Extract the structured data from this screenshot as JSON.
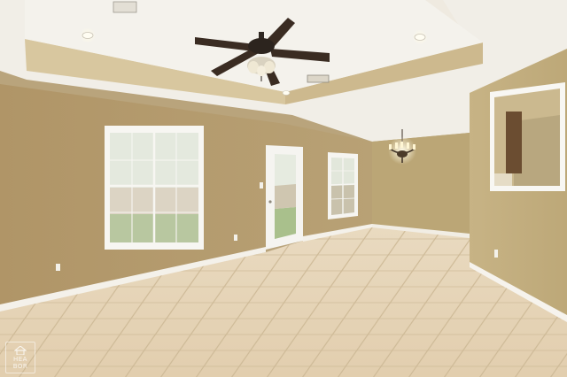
{
  "scene": {
    "subject": "empty-room-interior",
    "colors": {
      "wall": "#b39b6d",
      "wall_light": "#c4ad80",
      "ceiling": "#f2efe8",
      "tray": "#d9c9a2",
      "floor": "#e6d3b5",
      "baseboard": "#f4f1ea",
      "window_glass": "#dfe6d6",
      "trim": "#f7f6f2"
    }
  },
  "watermark": {
    "line1": "HEA",
    "line2": "BOR"
  }
}
